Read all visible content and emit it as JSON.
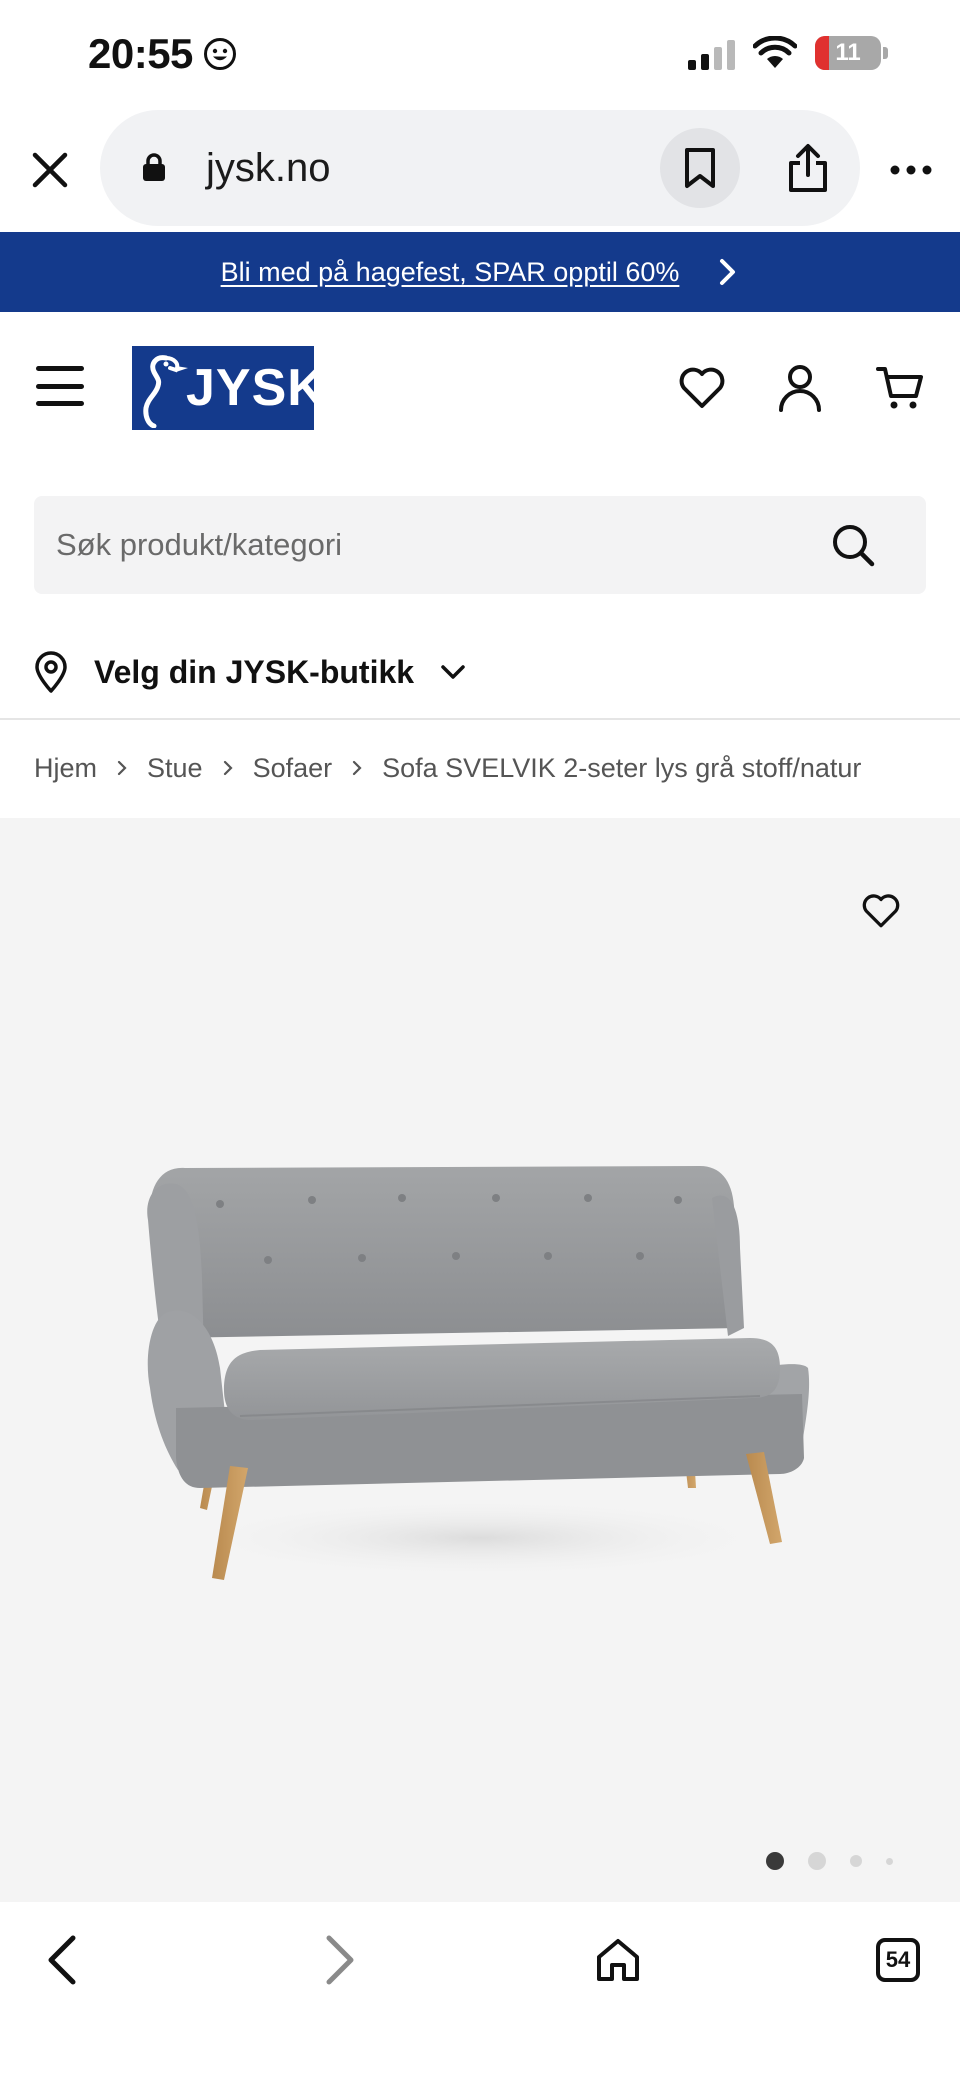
{
  "status_bar": {
    "time": "20:55",
    "battery": "11"
  },
  "browser": {
    "url": "jysk.no"
  },
  "promo": {
    "text": "Bli med på hagefest, SPAR opptil 60%"
  },
  "header": {
    "logo_text": "JYSK"
  },
  "search": {
    "placeholder": "Søk produkt/kategori"
  },
  "store": {
    "label": "Velg din JYSK-butikk"
  },
  "breadcrumb": [
    "Hjem",
    "Stue",
    "Sofaer",
    "Sofa SVELVIK 2-seter lys grå stoff/natur"
  ],
  "gallery": {
    "active_index": 0,
    "total": 4
  },
  "toolbar": {
    "tabs_count": "54"
  },
  "colors": {
    "brand_blue": "#143a8c",
    "gallery_bg": "#f4f4f4"
  }
}
